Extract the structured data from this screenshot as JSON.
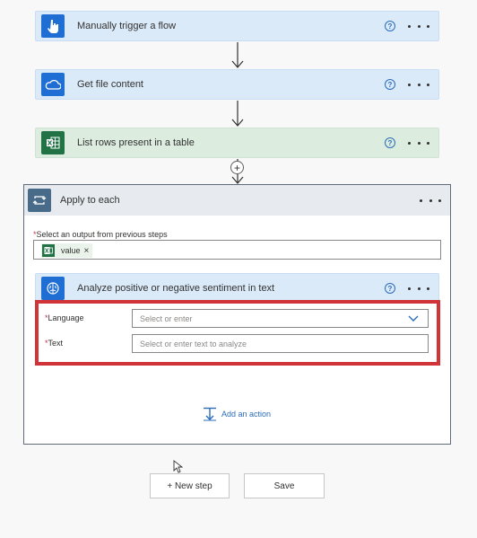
{
  "flow": {
    "steps": [
      {
        "title": "Manually trigger a flow",
        "icon": "touch-icon",
        "color": "#1f6ed4"
      },
      {
        "title": "Get file content",
        "icon": "onedrive-icon",
        "color": "#1f6ed4"
      },
      {
        "title": "List rows present in a table",
        "icon": "excel-icon",
        "color": "#217346"
      }
    ],
    "help_glyph": "?",
    "add_glyph": "+"
  },
  "apply_each": {
    "title": "Apply to each",
    "select_label": "Select an output from previous steps",
    "token_value": "value",
    "token_remove": "×",
    "inner_action": {
      "title": "Analyze positive or negative sentiment in text",
      "language_label": "Language",
      "language_placeholder": "Select or enter",
      "text_label": "Text",
      "text_placeholder": "Select or enter text to analyze"
    },
    "add_action_label": "Add an action"
  },
  "footer": {
    "new_step_label": "+ New step",
    "save_label": "Save"
  },
  "colors": {
    "card_blue": "#dbeaf9",
    "card_green": "#dcede0",
    "highlight_red": "#d13438",
    "accent": "#2b6cb8"
  },
  "required_mark": "*"
}
